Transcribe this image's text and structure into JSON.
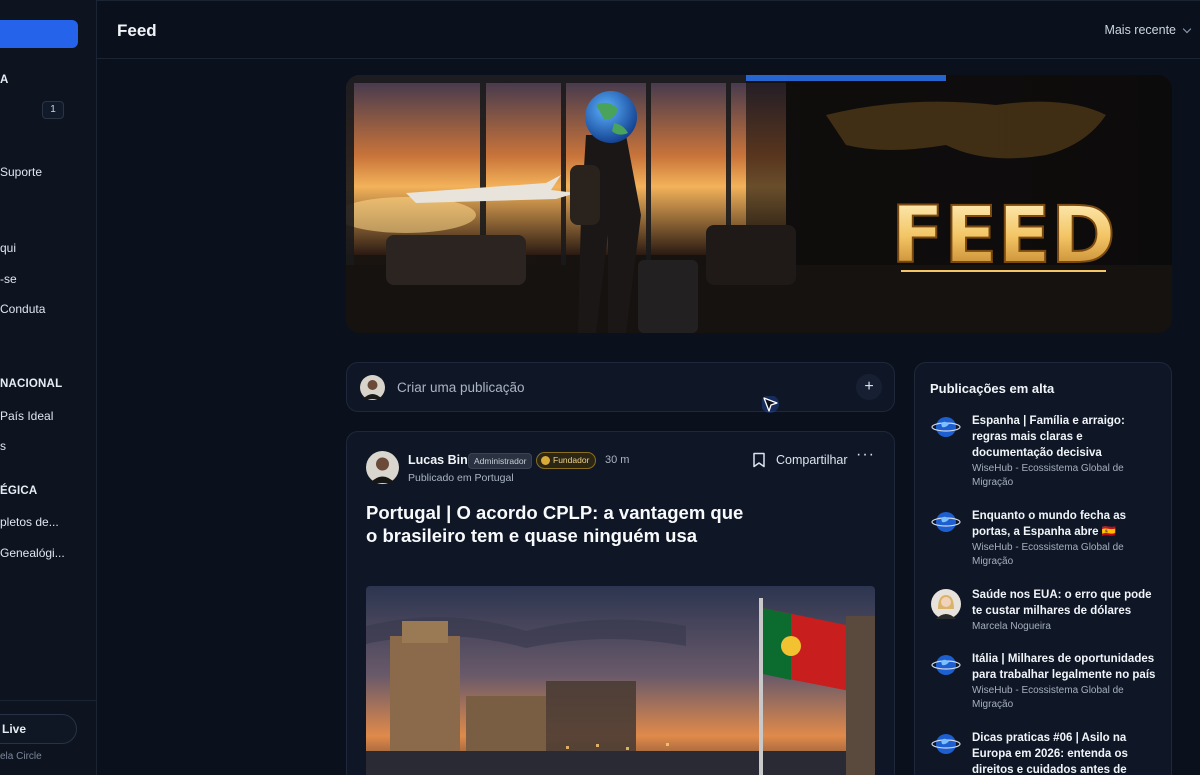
{
  "sidebar": {
    "items": [
      {
        "label": "A",
        "kind": "head"
      },
      {
        "label": "1",
        "kind": "badge"
      },
      {
        "label": "Suporte"
      },
      {
        "label": "qui"
      },
      {
        "label": "-se"
      },
      {
        "label": "Conduta"
      },
      {
        "label": "NACIONAL",
        "kind": "head"
      },
      {
        "label": "País Ideal"
      },
      {
        "label": "s"
      },
      {
        "label": "ÉGICA",
        "kind": "head"
      },
      {
        "label": "pletos de..."
      },
      {
        "label": "Genealógi..."
      }
    ],
    "live_label": "Live",
    "footer": "ela Circle"
  },
  "header": {
    "title": "Feed",
    "sort_label": "Mais recente"
  },
  "hero": {
    "banner_text": "FEED"
  },
  "composer": {
    "placeholder": "Criar uma publicação",
    "plus": "+"
  },
  "post": {
    "author": "Lucas Bin",
    "badge_admin": "Administrador",
    "badge_founder": "Fundador",
    "time": "30 m",
    "published": "Publicado em Portugal",
    "share_label": "Compartilhar",
    "more": "···",
    "title": "Portugal | O acordo CPLP: a vantagem que o brasileiro tem e quase ninguém usa"
  },
  "trending": {
    "title": "Publicações em alta",
    "items": [
      {
        "title": "Espanha | Família e arraigo: regras mais claras e documentação decisiva",
        "author": "WiseHub - Ecossistema Global de Migração",
        "avatar": "globe-icon"
      },
      {
        "title": "Enquanto o mundo fecha as portas, a Espanha abre 🇪🇸",
        "author": "WiseHub - Ecossistema Global de Migração",
        "avatar": "globe-icon"
      },
      {
        "title": "Saúde nos EUA: o erro que pode te custar milhares de dólares",
        "author": "Marcela Nogueira",
        "avatar": "person"
      },
      {
        "title": "Itália | Milhares de oportunidades para trabalhar legalmente no país",
        "author": "WiseHub - Ecossistema Global de Migração",
        "avatar": "globe-icon"
      },
      {
        "title": "Dicas praticas #06 | Asilo na Europa em 2026: entenda os direitos e cuidados antes de",
        "author": "",
        "avatar": "globe-icon"
      }
    ]
  },
  "colors": {
    "background": "#0b111c",
    "card": "#0f1726",
    "accent": "#2563eb",
    "founder_gold": "#d9a93a"
  }
}
